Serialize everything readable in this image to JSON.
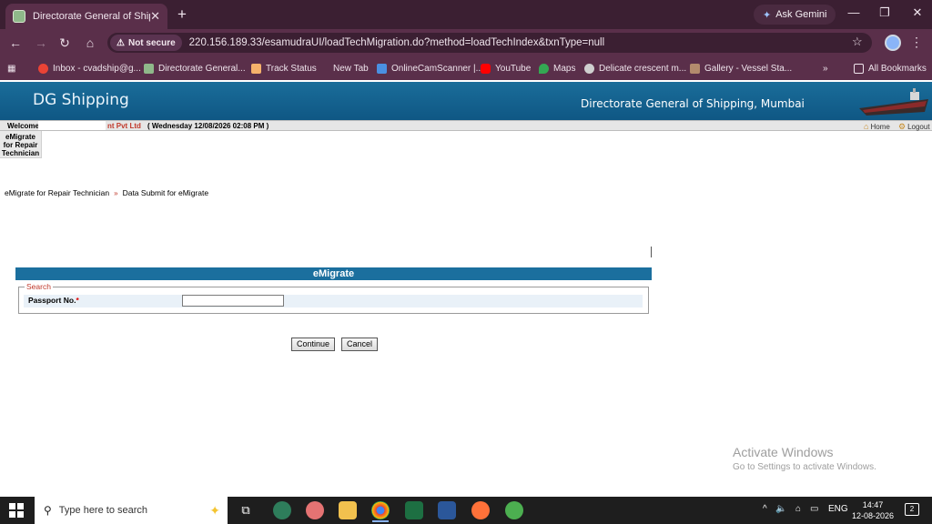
{
  "browser": {
    "tab_title": "Directorate General of Shipping",
    "tab_close": "✕",
    "new_tab": "+",
    "gemini_label": "Ask Gemini",
    "security_label": "Not secure",
    "url": "220.156.189.33/esamudraUI/loadTechMigration.do?method=loadTechIndex&txnType=null",
    "bookmarks": [
      {
        "label": "Inbox - cvadship@g...",
        "icon": "gmail-icon"
      },
      {
        "label": "Directorate General...",
        "icon": "dgs-icon"
      },
      {
        "label": "Track Status",
        "icon": "track-icon"
      },
      {
        "label": "New Tab",
        "icon": "newtab-icon"
      },
      {
        "label": "OnlineCamScanner |...",
        "icon": "camscanner-icon"
      },
      {
        "label": "YouTube",
        "icon": "youtube-icon"
      },
      {
        "label": "Maps",
        "icon": "maps-icon"
      },
      {
        "label": "Delicate crescent m...",
        "icon": "globe-icon"
      },
      {
        "label": "Gallery - Vessel Sta...",
        "icon": "gallery-icon"
      }
    ],
    "bookmarks_overflow": "»",
    "all_bookmarks": "All Bookmarks"
  },
  "site": {
    "logo_text": "DG Shipping",
    "org_name": "Directorate General of Shipping, Mumbai",
    "welcome_label": "Welcome",
    "company_fragment": "nt Pvt Ltd",
    "datetime": "( Wednesday 12/08/2026 02:08 PM )",
    "home_label": "Home",
    "logout_label": "Logout",
    "side_menu": "eMigrate for Repair Technician"
  },
  "breadcrumb": {
    "item1": "eMigrate for Repair Technician",
    "separator": "»",
    "item2": "Data Submit for eMigrate"
  },
  "form": {
    "panel_title": "eMigrate",
    "legend": "Search",
    "passport_label": "Passport No.",
    "required_mark": "*",
    "passport_value": "",
    "continue_label": "Continue",
    "cancel_label": "Cancel"
  },
  "watermark": {
    "line1": "Activate Windows",
    "line2": "Go to Settings to activate Windows."
  },
  "taskbar": {
    "search_placeholder": "Type here to search",
    "language": "ENG",
    "time": "14:47",
    "date": "12-08-2026",
    "notification_count": "2"
  }
}
